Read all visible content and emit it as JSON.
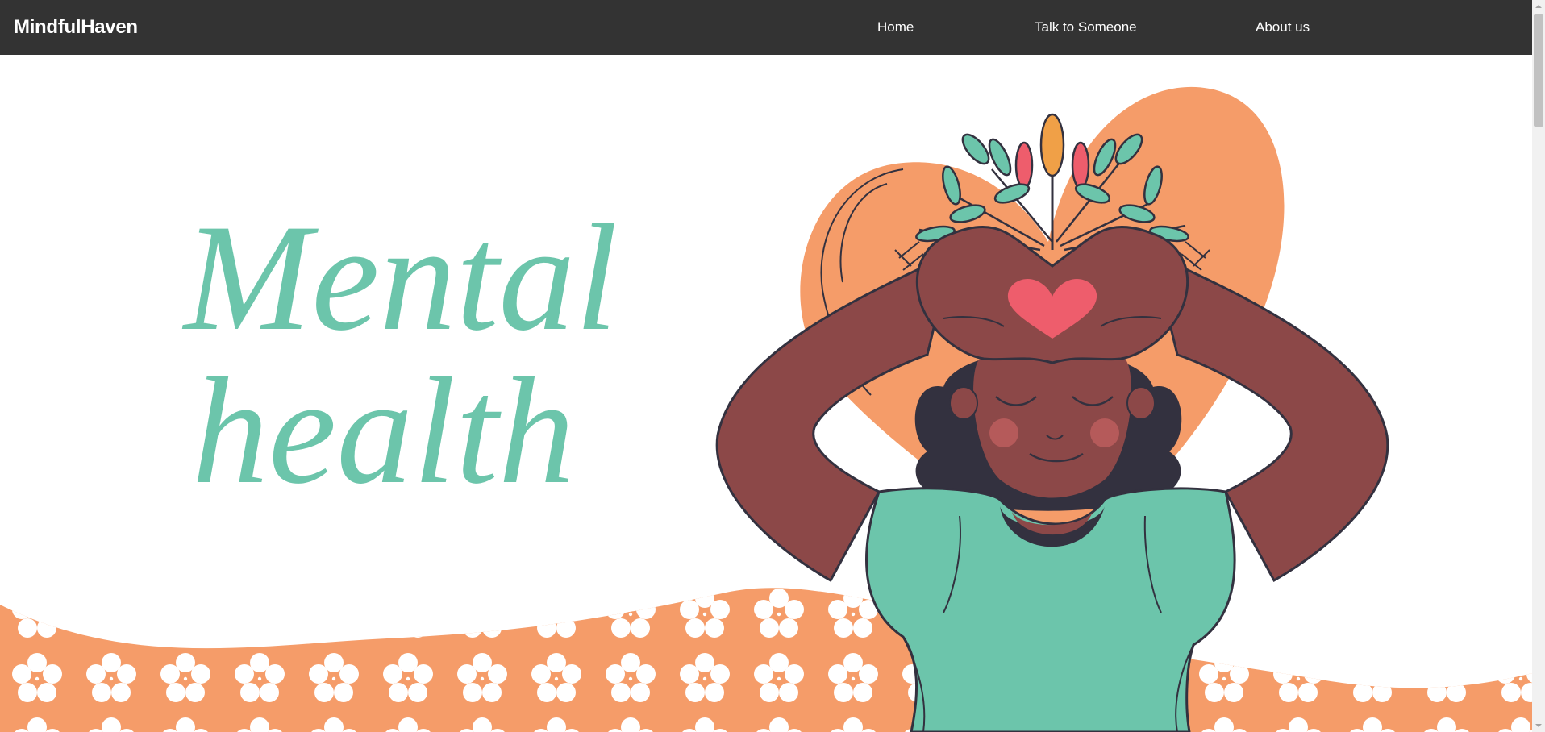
{
  "header": {
    "brand": "MindfulHaven",
    "nav": [
      {
        "label": "Home"
      },
      {
        "label": "Talk to Someone"
      },
      {
        "label": "About us"
      }
    ]
  },
  "hero": {
    "title_lines": [
      "Mental",
      "health"
    ]
  },
  "colors": {
    "nav_bg": "#333333",
    "nav_text": "#ffffff",
    "title_teal": "#6cc5ab",
    "accent_orange": "#f59c69",
    "skin": "#8c4848",
    "hair": "#33313f",
    "shirt": "#6cc5ab",
    "heart": "#ee5d6c"
  }
}
